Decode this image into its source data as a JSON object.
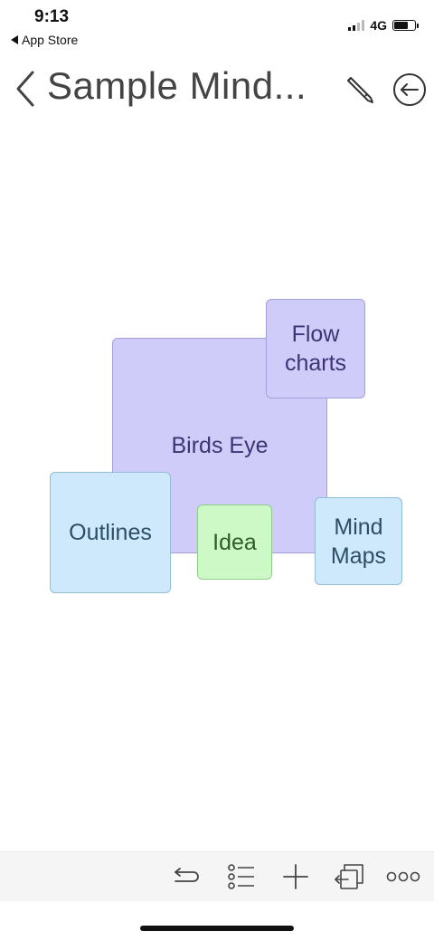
{
  "status_bar": {
    "time": "9:13",
    "back_app": "App Store",
    "network": "4G"
  },
  "nav": {
    "title": "Sample Mind...",
    "back_icon": "chevron-left-icon",
    "edit_icon": "pencil-icon",
    "exit_icon": "circle-arrow-left-icon"
  },
  "canvas": {
    "nodes": [
      {
        "label": "Birds Eye",
        "color": "#d0ccfa"
      },
      {
        "label": "Flow\ncharts",
        "color": "#d0ccfa"
      },
      {
        "label": "Outlines",
        "color": "#cde9fb"
      },
      {
        "label": "Idea",
        "color": "#ccf9c6"
      },
      {
        "label": "Mind\nMaps",
        "color": "#cde9fb"
      }
    ]
  },
  "toolbar": {
    "icons": [
      "undo-icon",
      "outline-list-icon",
      "plus-icon",
      "export-icon",
      "more-icon"
    ]
  },
  "colors": {
    "accent_text": "#444444",
    "toolbar_bg": "#f5f5f5"
  }
}
